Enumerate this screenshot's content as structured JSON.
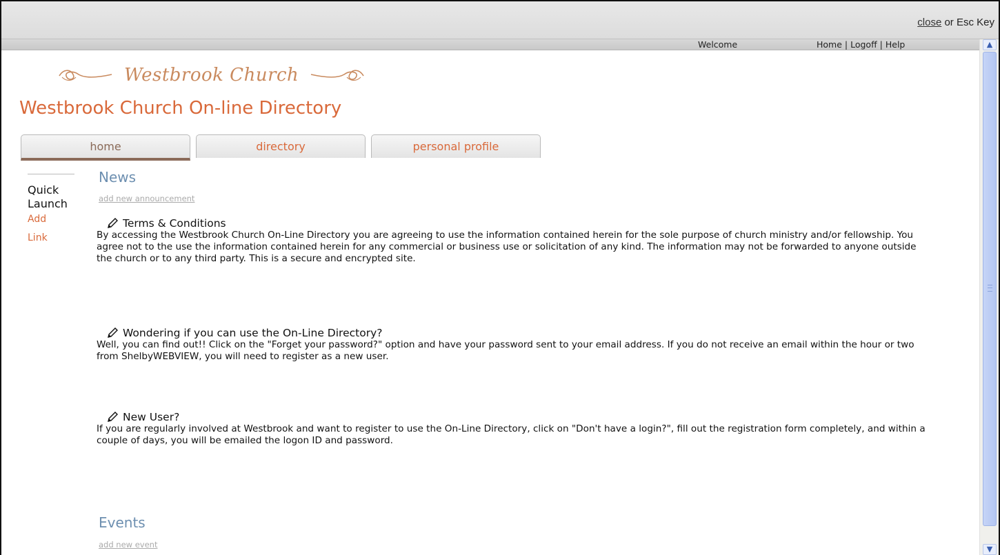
{
  "modal": {
    "close_link": "close",
    "close_suffix": " or Esc Key"
  },
  "topnav": {
    "welcome": "Welcome",
    "home": "Home",
    "sep1": " | ",
    "logoff": "Logoff",
    "sep2": " | ",
    "help": "Help"
  },
  "header": {
    "logo_text": "Westbrook Church",
    "title": "Westbrook Church On-line Directory"
  },
  "tabs": [
    {
      "label": "home",
      "active": true
    },
    {
      "label": "directory",
      "active": false
    },
    {
      "label": "personal profile",
      "active": false
    }
  ],
  "quick_launch": {
    "title": "Quick Launch",
    "links": [
      "Add",
      "Link"
    ]
  },
  "news": {
    "title": "News",
    "add_link": "add new announcement",
    "items": [
      {
        "heading": "Terms & Conditions",
        "body": "By accessing the Westbrook Church On-Line Directory you are agreeing to use the information contained herein for the sole purpose of church ministry and/or fellowship. You agree not to the use the information contained herein for any commercial or business use or solicitation of any kind. The information may not be forwarded to anyone outside the church or to any third party. This is a secure and encrypted site."
      },
      {
        "heading": "Wondering if you can use the On-Line Directory?",
        "body": "Well, you can find out!! Click on the \"Forget your password?\" option and have your password sent to your email address. If you do not receive an email within the hour or two from ShelbyWEBVIEW, you will need to register as a new user."
      },
      {
        "heading": "New User?",
        "body": "If you are regularly involved at Westbrook and want to register to use the On-Line Directory, click on \"Don't have a login?\", fill out the registration form completely, and within a couple of days, you will be emailed the logon ID and password."
      }
    ]
  },
  "events": {
    "title": "Events",
    "add_link": "add new event"
  },
  "colors": {
    "accent": "#d9693a",
    "section_title": "#6d8fb0",
    "active_tab": "#8a6a58"
  }
}
